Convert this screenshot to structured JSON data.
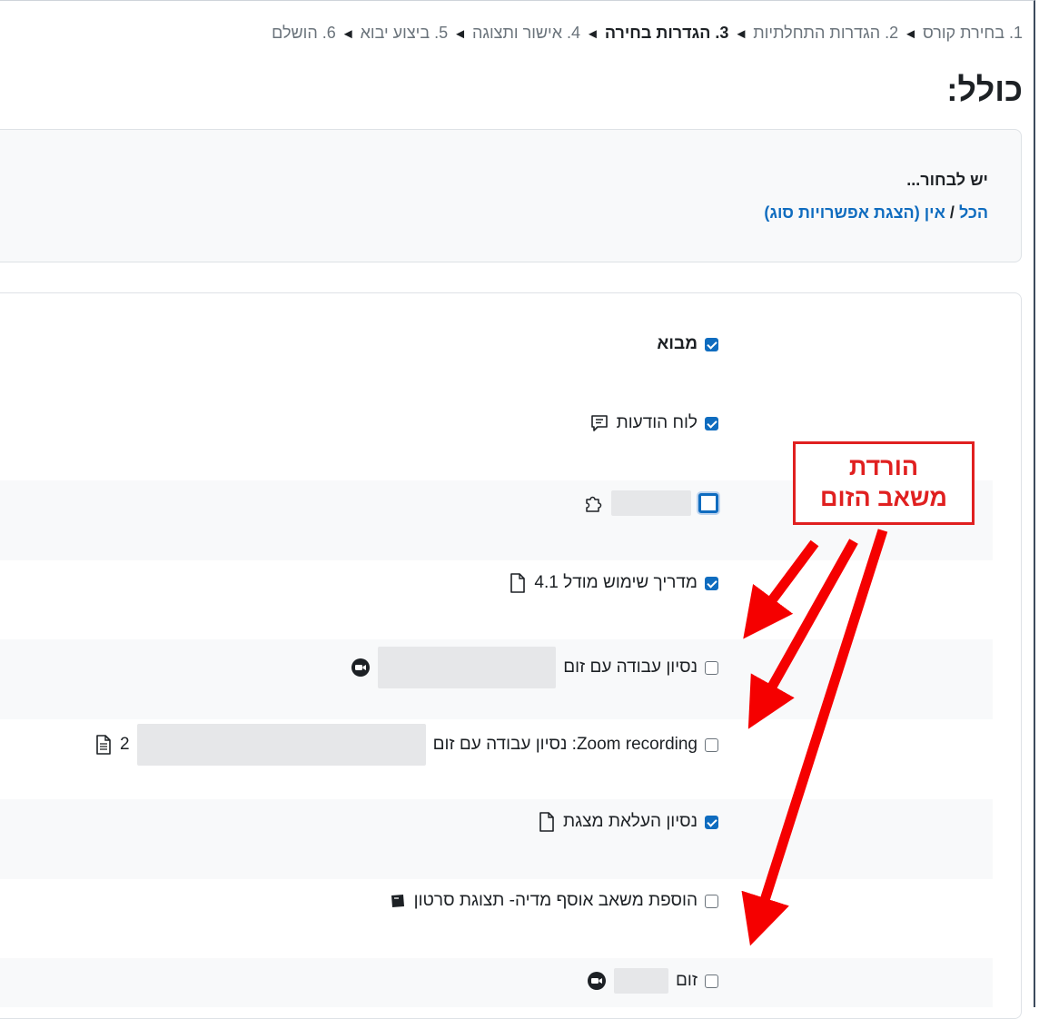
{
  "breadcrumb": {
    "steps": [
      {
        "label": "1. בחירת קורס",
        "current": false
      },
      {
        "label": "2. הגדרות התחלתיות",
        "current": false
      },
      {
        "label": "3. הגדרות בחירה",
        "current": true
      },
      {
        "label": "4. אישור ותצוגה",
        "current": false
      },
      {
        "label": "5. ביצוע יבוא",
        "current": false
      },
      {
        "label": "6. הושלם",
        "current": false
      }
    ],
    "separator": "◄"
  },
  "page_title": "כולל:",
  "select": {
    "heading": "יש לבחור...",
    "all_label": "הכל",
    "slash": "/",
    "none_label": "אין",
    "type_options_label": "(הצגת אפשרויות סוג)"
  },
  "items": [
    {
      "label": "מבוא",
      "checked": true,
      "icon": "none"
    },
    {
      "label": "לוח הודעות",
      "checked": true,
      "icon": "forum-icon"
    },
    {
      "label": "",
      "checked": false,
      "icon": "puzzle-icon"
    },
    {
      "label": "מדריך שימוש מודל 4.1",
      "checked": true,
      "icon": "file-icon"
    },
    {
      "label": "נסיון עבודה עם זום",
      "checked": false,
      "icon": "zoom-icon"
    },
    {
      "label": "Zoom recording: נסיון עבודה עם זום",
      "checked": false,
      "icon": "page-icon",
      "trailing": "2"
    },
    {
      "label": "נסיון העלאת מצגת",
      "checked": true,
      "icon": "file-icon"
    },
    {
      "label": "הוספת משאב אוסף מדיה- תצוגת סרטון",
      "checked": false,
      "icon": "media-icon"
    },
    {
      "label": "זום",
      "checked": false,
      "icon": "zoom-icon"
    }
  ],
  "callout": {
    "line1": "הורדת",
    "line2": "משאב הזום"
  },
  "colors": {
    "accent": "#0f6cbf",
    "annotation_red": "#e02020"
  }
}
